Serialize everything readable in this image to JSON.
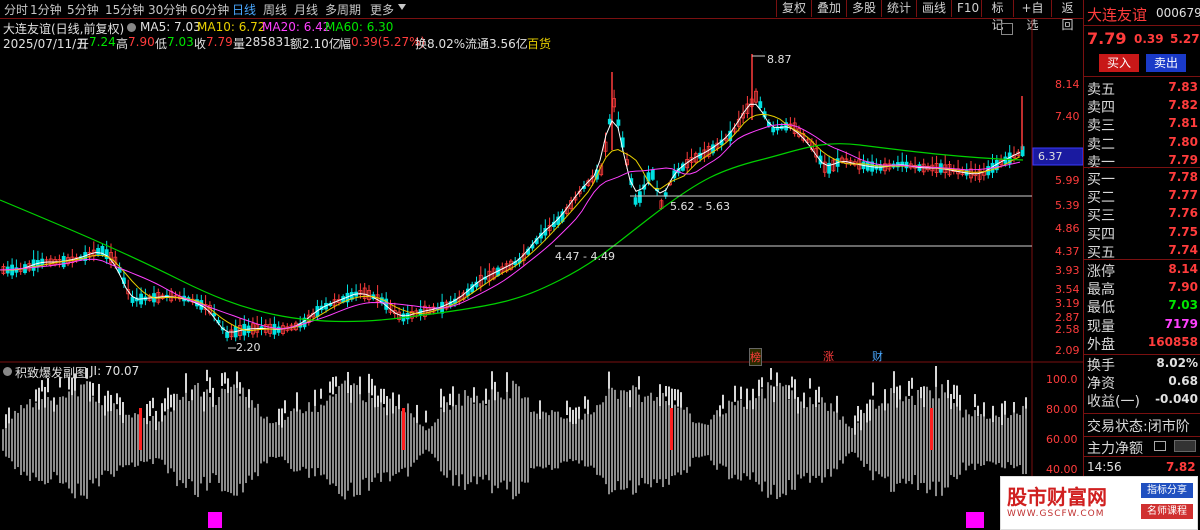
{
  "toolbar": {
    "periods": [
      "分时",
      "1分钟",
      "5分钟",
      "15分钟",
      "30分钟",
      "60分钟",
      "日线",
      "周线",
      "月线",
      "多周期",
      "更多"
    ],
    "buttons": [
      "复权",
      "叠加",
      "多股",
      "统计",
      "画线",
      "F10",
      "标记",
      "+自选",
      "返回"
    ]
  },
  "info": {
    "title": "大连友谊(日线,前复权)",
    "ma5": "MA5: 7.03",
    "ma10": "MA10: 6.72",
    "ma20": "MA20: 6.42",
    "ma60": "MA60: 6.30",
    "date": "2025/07/11/五",
    "open_label": "开",
    "open": "7.24",
    "high_label": "高",
    "high": "7.90",
    "low_label": "低",
    "low": "7.03",
    "close_label": "收",
    "close": "7.79",
    "vol_label": "量",
    "vol": "285831",
    "amount_label": "额",
    "amount": "2.10亿",
    "chg_label": "幅",
    "chg": "0.39(5.27%)",
    "turnover": "换8.02%",
    "float": "流通3.56亿",
    "industry": "百货"
  },
  "price_axis": [
    "8.14",
    "7.40",
    "6.37",
    "5.99",
    "5.39",
    "4.86",
    "4.37",
    "3.93",
    "3.54",
    "3.19",
    "2.87",
    "2.58",
    "2.09"
  ],
  "annotations": {
    "peak": "8.87",
    "low": "2.20",
    "range1": "5.62 - 5.63",
    "range2": "4.47 - 4.49",
    "current_price_tag": "6.37"
  },
  "event_markers": [
    "榜",
    "涨",
    "财"
  ],
  "subchart": {
    "title": "积致爆发副图",
    "ji": "JI: 70.07",
    "axis": [
      "100.0",
      "80.00",
      "60.00",
      "40.00"
    ]
  },
  "quote": {
    "name": "大连友谊",
    "code": "000679",
    "price": "7.79",
    "change": "0.39",
    "change_pct": "5.27%",
    "buy_btn": "买入",
    "sell_btn": "卖出",
    "asks": [
      {
        "label": "卖五",
        "price": "7.83"
      },
      {
        "label": "卖四",
        "price": "7.82"
      },
      {
        "label": "卖三",
        "price": "7.81"
      },
      {
        "label": "卖二",
        "price": "7.80"
      },
      {
        "label": "卖一",
        "price": "7.79"
      }
    ],
    "bids": [
      {
        "label": "买一",
        "price": "7.78"
      },
      {
        "label": "买二",
        "price": "7.77"
      },
      {
        "label": "买三",
        "price": "7.76"
      },
      {
        "label": "买四",
        "price": "7.75"
      },
      {
        "label": "买五",
        "price": "7.74"
      }
    ],
    "stats": [
      {
        "label": "涨停",
        "value": "8.14",
        "color": "red"
      },
      {
        "label": "最高",
        "value": "7.90",
        "color": "red"
      },
      {
        "label": "最低",
        "value": "7.03",
        "color": "green"
      },
      {
        "label": "现量",
        "value": "7179",
        "color": "magenta"
      },
      {
        "label": "外盘",
        "value": "160858",
        "color": "red"
      }
    ],
    "stats2": [
      {
        "label": "换手",
        "value": "8.02%"
      },
      {
        "label": "净资",
        "value": "0.68"
      },
      {
        "label": "收益(一)",
        "value": "-0.040"
      }
    ],
    "trade_status": "交易状态:闭市阶",
    "main_flow": "主力净额",
    "tick_time": "14:56",
    "tick_price": "7.82"
  },
  "watermark": {
    "name": "股市财富网",
    "url": "WWW.GSCFW.COM",
    "tag1": "指标分享",
    "tag2": "名师课程"
  },
  "colors": {
    "up": "#ff3c3c",
    "down": "#00e0e0",
    "ma5": "#ffffff",
    "ma10": "#e8d000",
    "ma20": "#ff40ff",
    "ma60": "#00d000",
    "frame": "#7a1010"
  }
}
